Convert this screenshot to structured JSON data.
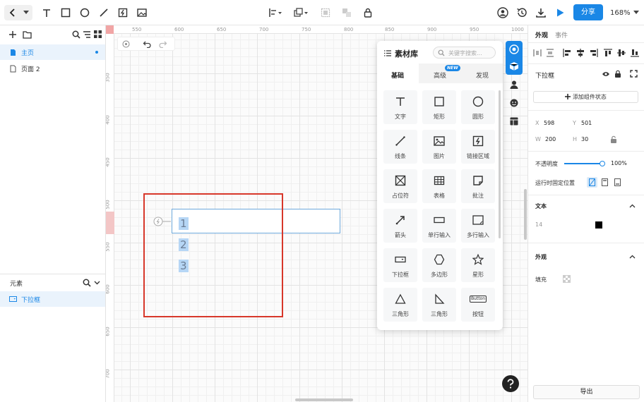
{
  "toolbar": {
    "share": "分享",
    "zoom": "168%"
  },
  "pages": [
    {
      "label": "主页"
    },
    {
      "label": "页面 2"
    }
  ],
  "elements": {
    "title": "元素",
    "items": [
      {
        "label": "下拉框"
      }
    ]
  },
  "ruler": {
    "h": [
      "550",
      "600",
      "650",
      "700",
      "750",
      "800",
      "850",
      "900",
      "950",
      "1000"
    ],
    "v": [
      "350",
      "400",
      "450",
      "500",
      "550",
      "600",
      "650",
      "700"
    ]
  },
  "dropdown": {
    "options": [
      "1",
      "2",
      "3"
    ]
  },
  "library": {
    "title": "素材库",
    "search_placeholder": "关键字搜索...",
    "tabs": [
      {
        "label": "基础"
      },
      {
        "label": "高级"
      },
      {
        "label": "发现"
      }
    ],
    "new_badge": "NEW",
    "items": [
      {
        "label": "文字",
        "icon": "text-icon"
      },
      {
        "label": "矩形",
        "icon": "rectangle-icon"
      },
      {
        "label": "圆形",
        "icon": "circle-icon"
      },
      {
        "label": "线条",
        "icon": "line-icon"
      },
      {
        "label": "图片",
        "icon": "image-icon"
      },
      {
        "label": "链接区域",
        "icon": "link-area-icon"
      },
      {
        "label": "占位符",
        "icon": "placeholder-icon"
      },
      {
        "label": "表格",
        "icon": "table-icon"
      },
      {
        "label": "批注",
        "icon": "note-icon"
      },
      {
        "label": "箭头",
        "icon": "arrow-icon"
      },
      {
        "label": "单行输入",
        "icon": "input-icon"
      },
      {
        "label": "多行输入",
        "icon": "textarea-icon"
      },
      {
        "label": "下拉框",
        "icon": "dropdown-icon"
      },
      {
        "label": "多边形",
        "icon": "polygon-icon"
      },
      {
        "label": "星形",
        "icon": "star-icon"
      },
      {
        "label": "三角形",
        "icon": "triangle-icon"
      },
      {
        "label": "三角形",
        "icon": "right-triangle-icon"
      },
      {
        "label": "按钮",
        "icon": "button-icon"
      }
    ],
    "button_sample": "Button"
  },
  "inspector": {
    "tabs": [
      {
        "label": "外观"
      },
      {
        "label": "事件"
      }
    ],
    "component_name": "下拉框",
    "add_state": "添加组件状态",
    "x_label": "X",
    "x": "598",
    "y_label": "Y",
    "y": "501",
    "w_label": "W",
    "w": "200",
    "h_label": "H",
    "h": "30",
    "opacity_label": "不透明度",
    "opacity": "100%",
    "opacity_value": 1.0,
    "fixed_label": "运行时固定位置",
    "text_section": "文本",
    "font_size": "14",
    "text_color": "#000000",
    "appearance_section": "外观",
    "fill_label": "填充",
    "export": "导出"
  },
  "colors": {
    "accent": "#1a87e6",
    "selection": "#d7372a"
  }
}
